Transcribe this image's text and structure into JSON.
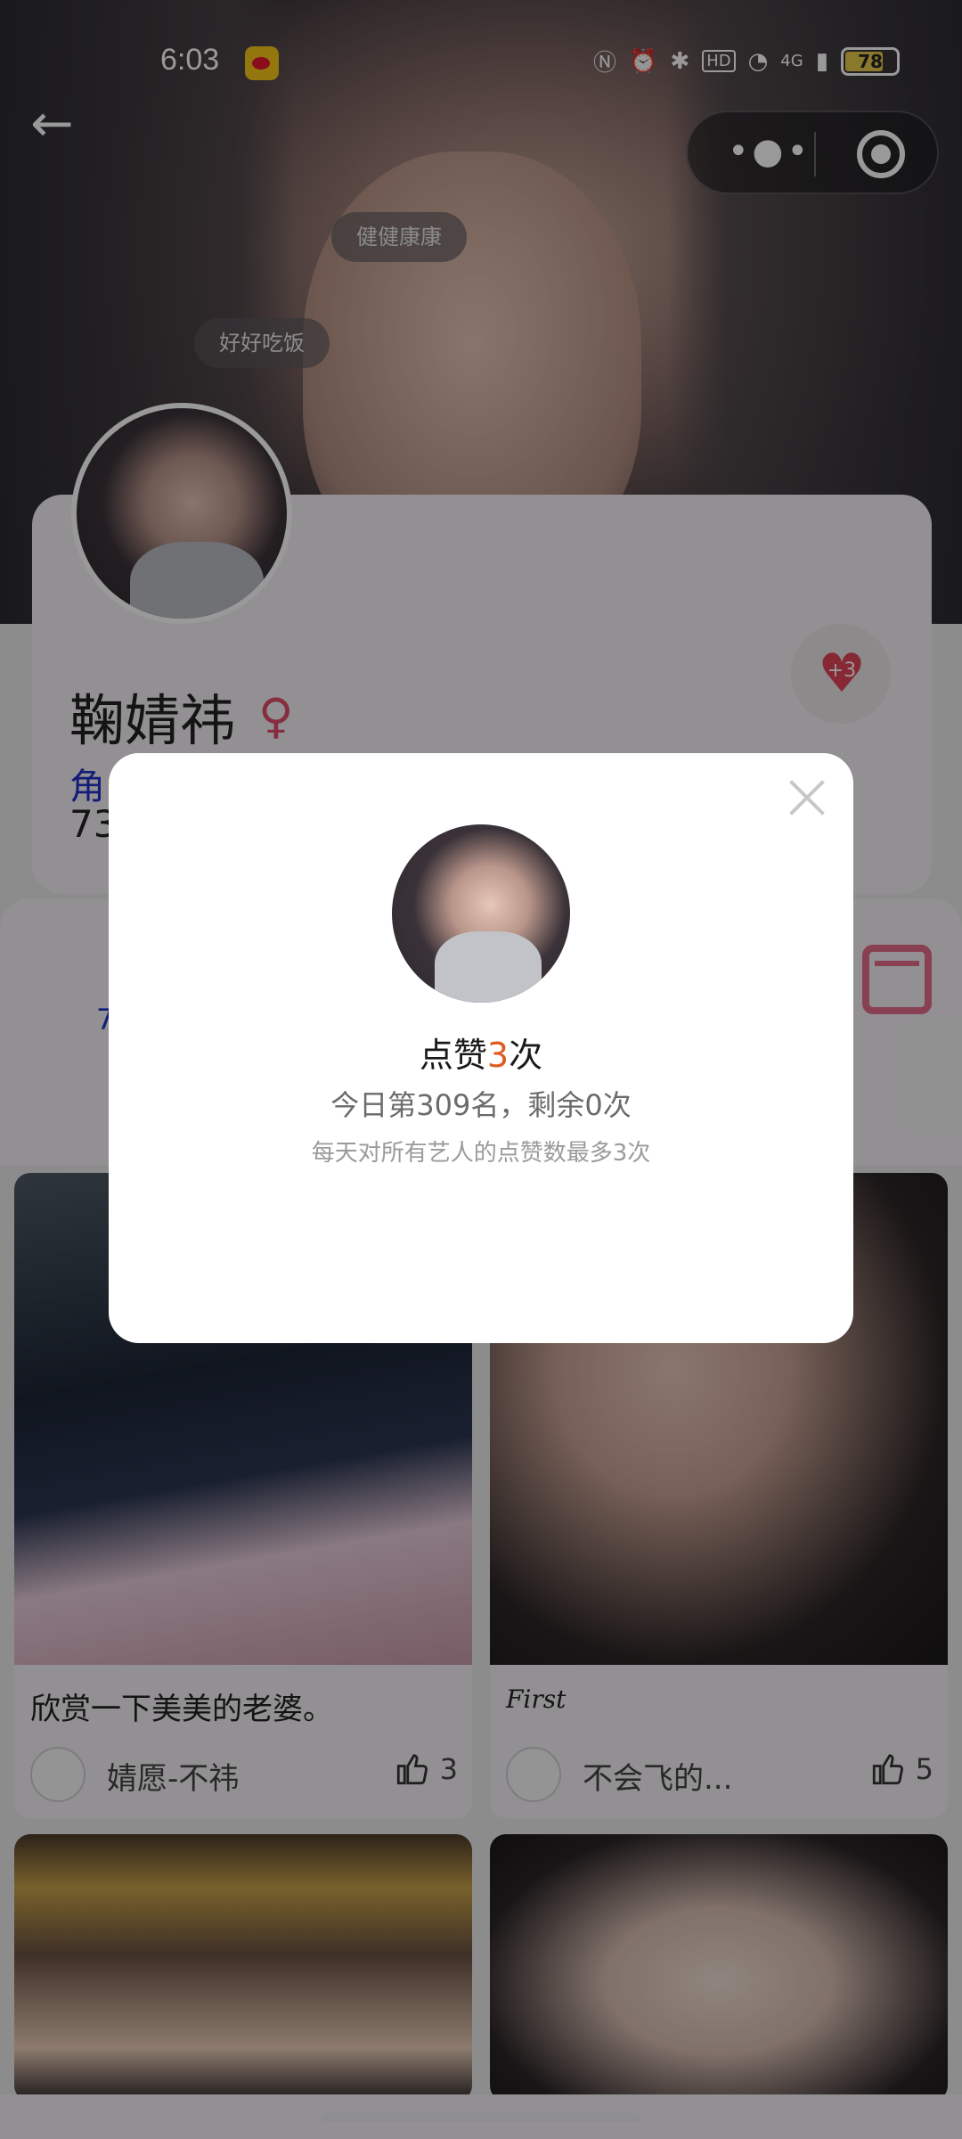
{
  "status_bar": {
    "time": "6:03",
    "battery": "78",
    "network": "4G"
  },
  "danmu": {
    "item1": "健健康康",
    "item2": "好好吃饭"
  },
  "profile": {
    "name": "鞠婧祎",
    "role_partial": "角",
    "number_partial": "73",
    "like_badge": "+3"
  },
  "tab_glimpse": "7",
  "posts": [
    {
      "caption": "欣赏一下美美的老婆。",
      "author": "婧愿-不祎",
      "likes": "3"
    },
    {
      "caption": "First",
      "author": "不会飞的...",
      "likes": "5"
    }
  ],
  "modal": {
    "title_prefix": "点赞",
    "title_count": "3",
    "title_suffix": "次",
    "rank_text": "今日第309名，剩余0次",
    "note_text": "每天对所有艺人的点赞数最多3次"
  },
  "colors": {
    "accent_orange": "#e05a1f",
    "heart_red": "#e04559",
    "link_blue": "#2030c8"
  }
}
